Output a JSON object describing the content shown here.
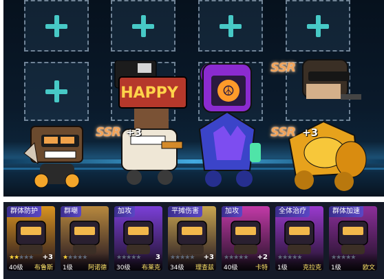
{
  "scene": {
    "slots": [
      {
        "id": "slot-1"
      },
      {
        "id": "slot-2"
      },
      {
        "id": "slot-3"
      },
      {
        "id": "slot-4"
      },
      {
        "id": "slot-5"
      }
    ],
    "characters": [
      {
        "name": "blue-box-hero",
        "rarity": "",
        "plus": ""
      },
      {
        "name": "tv-head-hero",
        "rarity": "SSR",
        "plus": "+3"
      },
      {
        "name": "peace-robot-hero",
        "rarity": "",
        "plus": ""
      },
      {
        "name": "gold-armor-hero",
        "rarity": "SSR",
        "plus": "+3"
      }
    ],
    "top_ssr": "SSR",
    "ssr_labels": [
      "SSR",
      "SSR",
      "SSR"
    ],
    "plus_labels": [
      "+3",
      "+3"
    ]
  },
  "cards": [
    {
      "tag": "群体防护",
      "stars": 2,
      "plus": "+3",
      "level": "40级",
      "name": "布鲁斯",
      "color": "#d99420"
    },
    {
      "tag": "群嘲",
      "stars": 1,
      "plus": "",
      "level": "1级",
      "name": "阿诺德",
      "color": "#b8893e"
    },
    {
      "tag": "加攻",
      "stars": 0,
      "plus": "3",
      "level": "30级",
      "name": "布莱克",
      "color": "#7b3fd8"
    },
    {
      "tag": "平摊伤害",
      "stars": 0,
      "plus": "+3",
      "level": "34级",
      "name": "理查兹",
      "color": "#c9a650"
    },
    {
      "tag": "加攻",
      "stars": 0,
      "plus": "+2",
      "level": "40级",
      "name": "卡特",
      "color": "#c33aa8"
    },
    {
      "tag": "全体治疗",
      "stars": 0,
      "plus": "",
      "level": "1级",
      "name": "克拉克",
      "color": "#9a3acf"
    },
    {
      "tag": "群体加速",
      "stars": 0,
      "plus": "",
      "level": "1级",
      "name": "欧文",
      "color": "#8c2f9a"
    }
  ],
  "colors": {
    "scene_bg": "#0a1a2b",
    "plus_color": "#47c9c6",
    "tag_bg": "#4a3aa8",
    "bar_bg": "#151a28",
    "name_color": "#ffe66a"
  }
}
